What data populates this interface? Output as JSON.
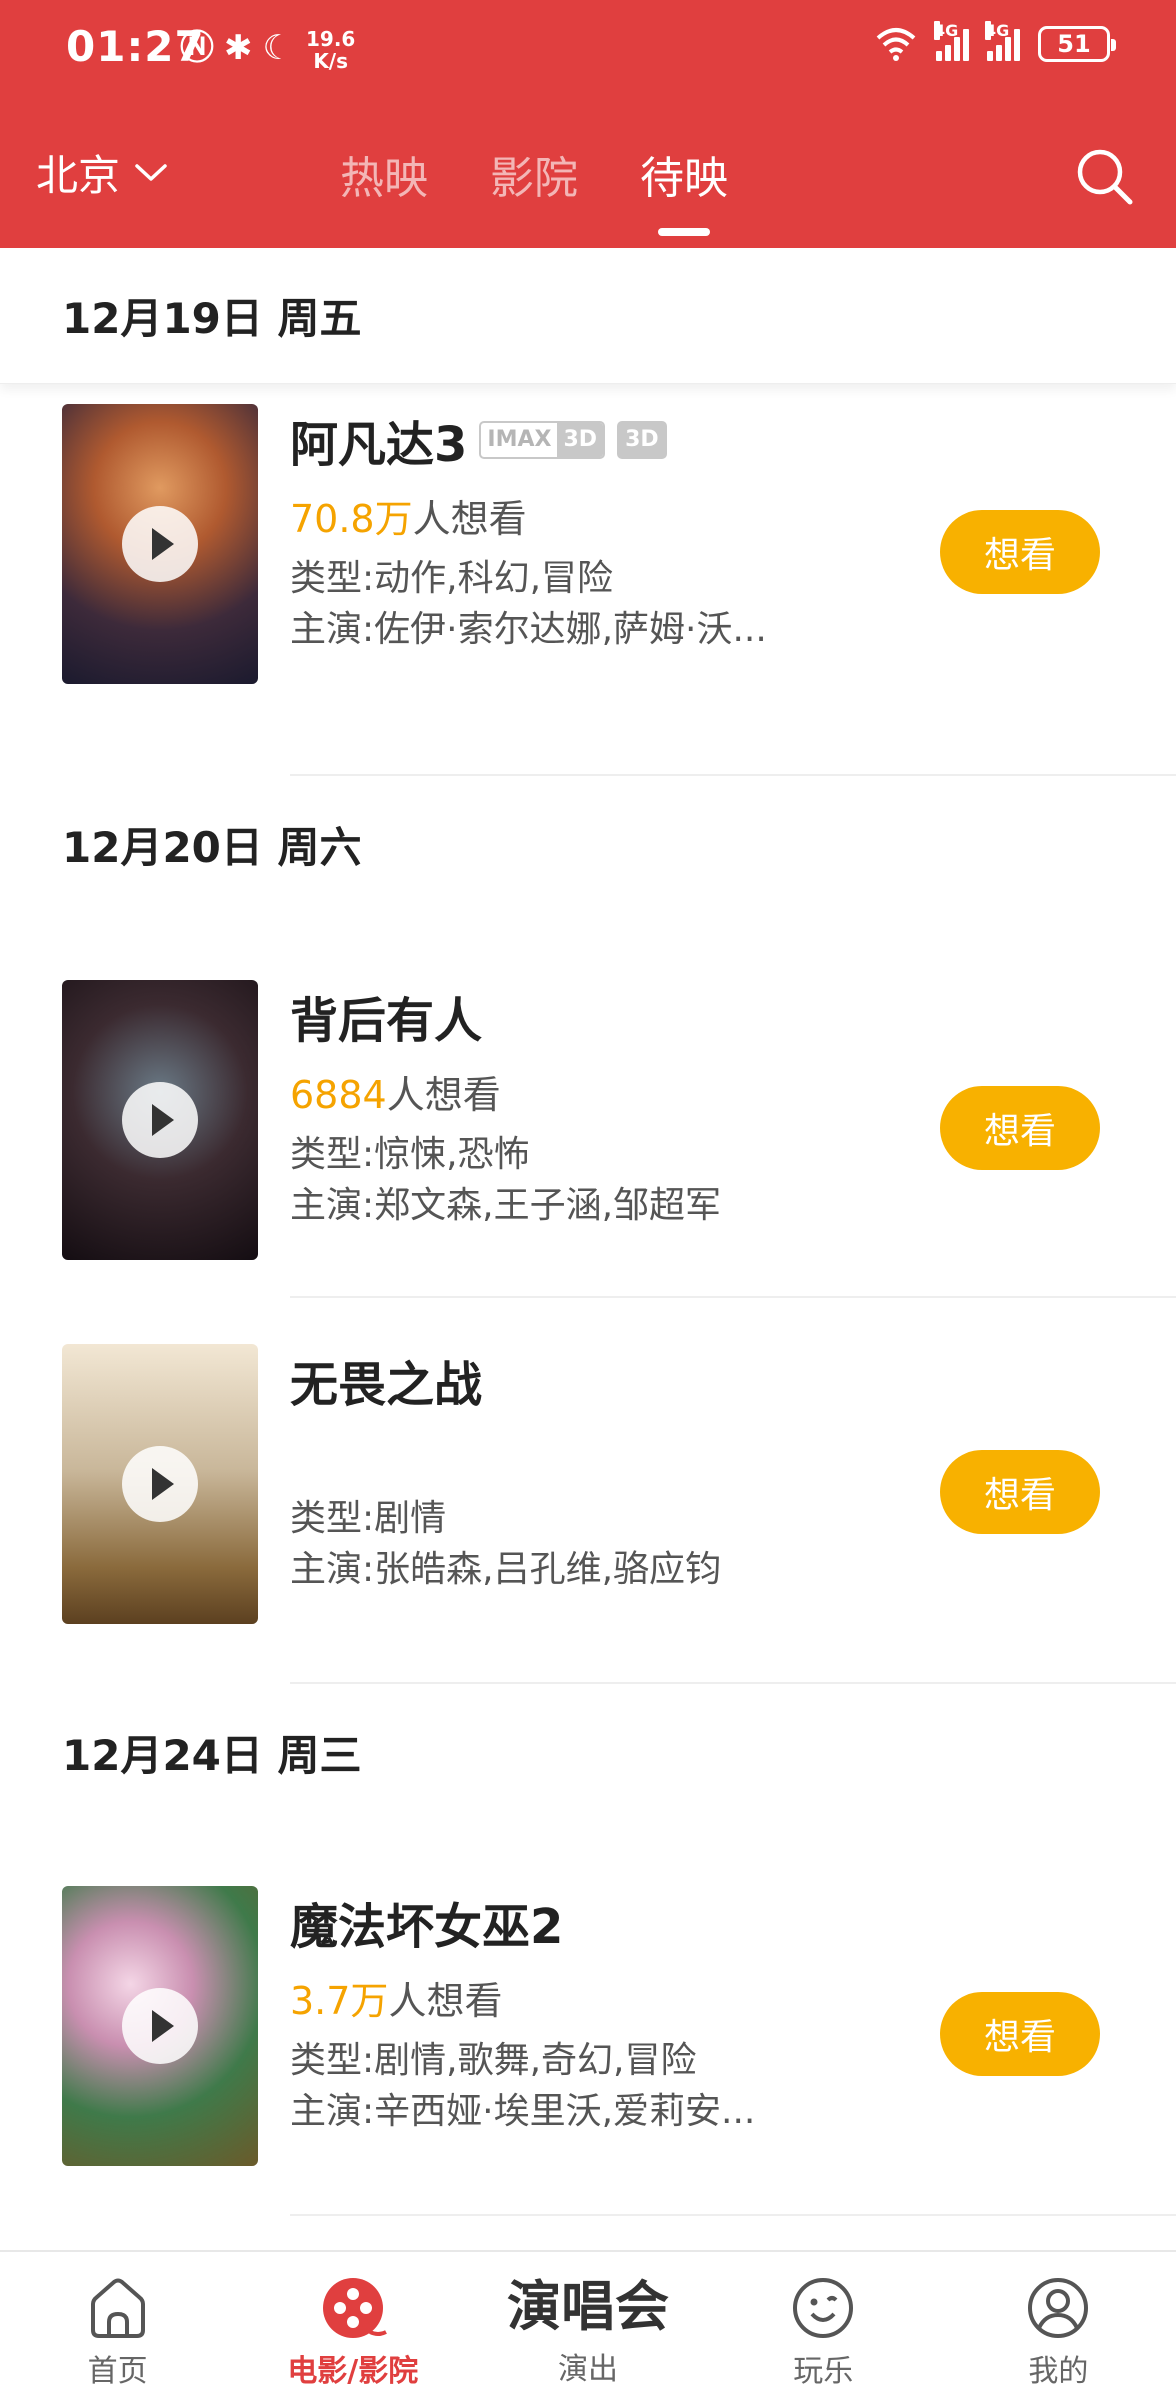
{
  "status_bar": {
    "time": "01:27",
    "speed_value": "19.6",
    "speed_unit": "K/s",
    "signal1": "4G",
    "signal2": "4G",
    "battery": "51"
  },
  "nav": {
    "city": "北京",
    "tabs": [
      {
        "label": "热映"
      },
      {
        "label": "影院"
      },
      {
        "label": "待映"
      }
    ],
    "active_tab": "待映"
  },
  "sections": [
    {
      "date": "12月19日 周五",
      "movies": [
        {
          "title": "阿凡达3",
          "badges": [
            "IMAX",
            "3D",
            "3D"
          ],
          "want_num": "70.8万",
          "want_suffix": "人想看",
          "genre": "类型:动作,科幻,冒险",
          "cast": "主演:佐伊·索尔达娜,萨姆·沃...",
          "button": "想看"
        }
      ]
    },
    {
      "date": "12月20日 周六",
      "movies": [
        {
          "title": "背后有人",
          "want_num": "6884",
          "want_suffix": "人想看",
          "genre": "类型:惊悚,恐怖",
          "cast": "主演:郑文森,王子涵,邹超军",
          "button": "想看"
        },
        {
          "title": "无畏之战",
          "genre": "类型:剧情",
          "cast": "主演:张皓森,吕孔维,骆应钧",
          "button": "想看"
        }
      ]
    },
    {
      "date": "12月24日 周三",
      "movies": [
        {
          "title": "魔法坏女巫2",
          "want_num": "3.7万",
          "want_suffix": "人想看",
          "genre": "类型:剧情,歌舞,奇幻,冒险",
          "cast": "主演:辛西娅·埃里沃,爱莉安...",
          "button": "想看"
        }
      ]
    }
  ],
  "bottom_bar": {
    "items": [
      {
        "label": "首页",
        "icon": "home-icon"
      },
      {
        "label": "电影/影院",
        "icon": "film-reel-icon"
      },
      {
        "label": "演出",
        "big_text": "演唱会"
      },
      {
        "label": "玩乐",
        "icon": "smiley-icon"
      },
      {
        "label": "我的",
        "icon": "user-icon"
      }
    ],
    "active": "电影/影院"
  },
  "colors": {
    "brand_red": "#e03f3f",
    "want_yellow": "#f8b100",
    "want_count_orange": "#f5a300"
  }
}
